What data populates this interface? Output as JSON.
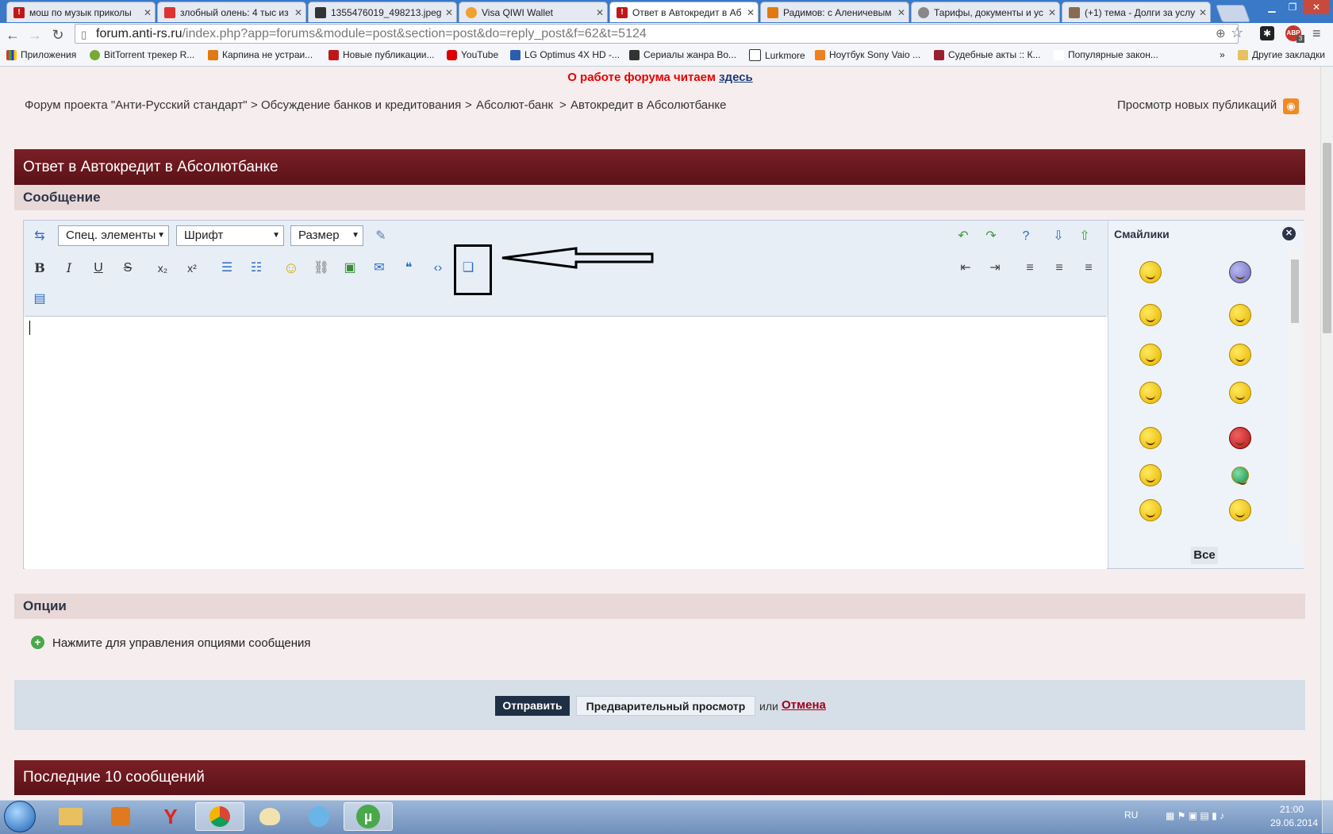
{
  "browser": {
    "tabs": [
      {
        "label": "мош по музык приколы",
        "active": false
      },
      {
        "label": "злобный олень: 4 тыс из",
        "active": false
      },
      {
        "label": "1355476019_498213.jpeg",
        "active": false
      },
      {
        "label": "Visa QIWI Wallet",
        "active": false
      },
      {
        "label": "Ответ в Автокредит в Аб",
        "active": true
      },
      {
        "label": "Радимов: с Аленичевым",
        "active": false
      },
      {
        "label": "Тарифы, документы и ус",
        "active": false
      },
      {
        "label": "(+1) тема - Долги за услу",
        "active": false
      }
    ],
    "url_host": "forum.anti-rs.ru",
    "url_rest": "/index.php?app=forums&module=post&section=post&do=reply_post&f=62&t=5124",
    "bookmarks": [
      "Приложения",
      "BitTorrent трекер R...",
      "Карпина не устраи...",
      "Новые публикации...",
      "YouTube",
      "LG Optimus 4X HD -...",
      "Сериалы жанра Во...",
      "Lurkmore",
      "Ноутбук Sony Vaio ...",
      "Судебные акты :: К...",
      "Популярные закон..."
    ],
    "bookmarks_more": "»",
    "other_bookmarks": "Другие закладки",
    "abp_count": "3"
  },
  "page": {
    "notice_text": "О работе форума читаем ",
    "notice_link": "здесь",
    "breadcrumb": [
      "Форум проекта \"Анти-Русский стандарт\"",
      "Обсуждение банков и кредитования",
      "Абсолют-банк",
      "Автокредит в Абсолютбанке"
    ],
    "breadcrumb_sep": ">",
    "new_posts": "Просмотр новых публикаций",
    "reply_title": "Ответ в Автокредит в Абсолютбанке",
    "message_header": "Сообщение",
    "editor": {
      "special": "Спец. элементы",
      "font": "Шрифт",
      "size": "Размер"
    },
    "smileys_title": "Смайлики",
    "smileys_all": "Все",
    "options_header": "Опции",
    "options_link": "Нажмите для управления опциями сообщения",
    "send": "Отправить",
    "preview": "Предварительный просмотр",
    "or": "или",
    "cancel": "Отмена",
    "last_posts": "Последние 10 сообщений"
  },
  "taskbar": {
    "lang": "RU",
    "time": "21:00",
    "date": "29.06.2014"
  },
  "colors": {
    "header_bar": "#6a1820",
    "notice": "#e60000",
    "send_button": "#1f2f45",
    "cancel_link": "#a3001b"
  }
}
